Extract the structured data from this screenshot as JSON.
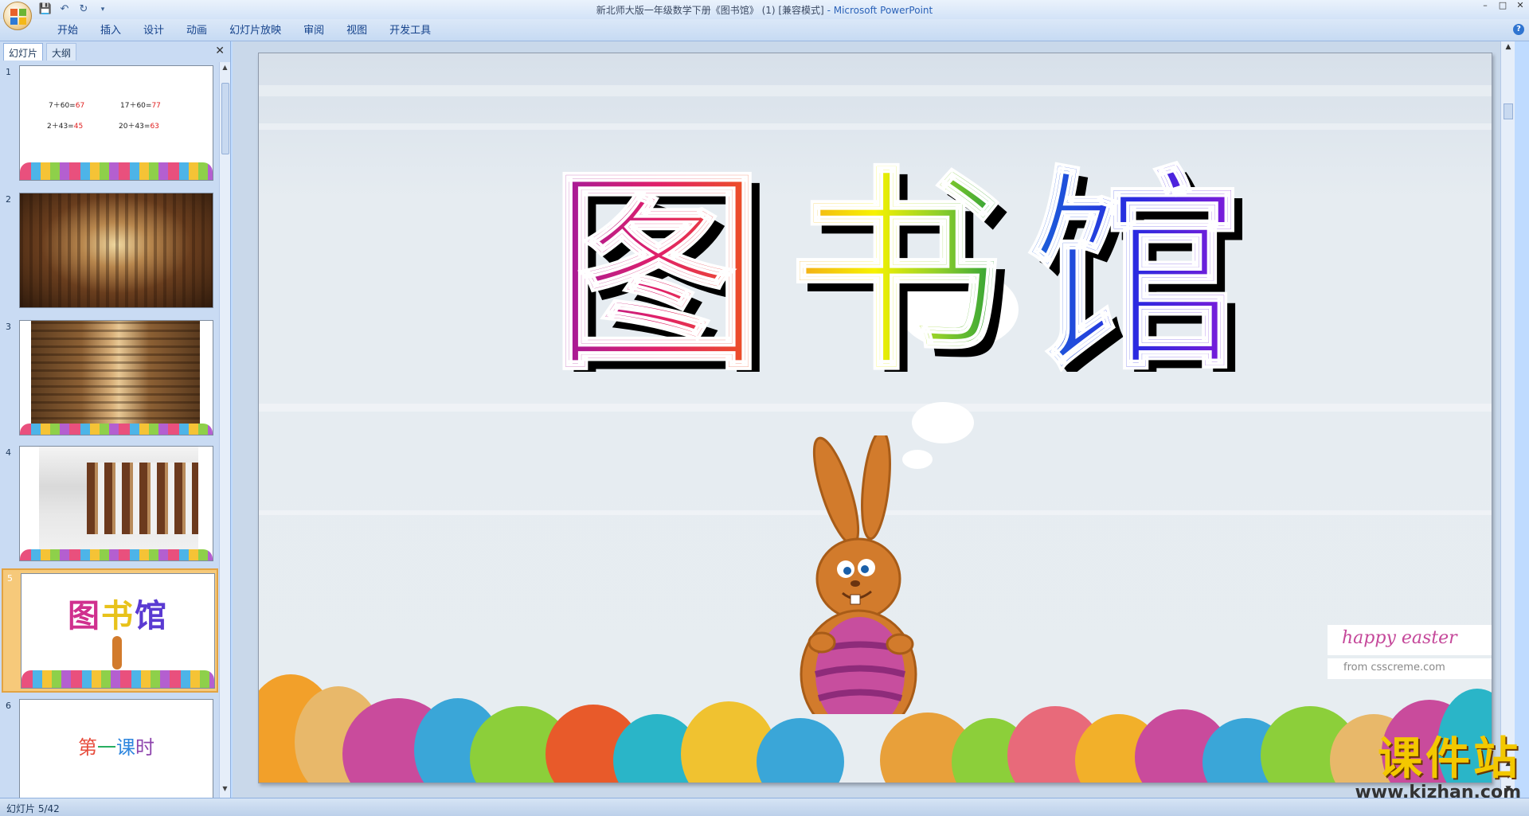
{
  "window": {
    "title": "新北师大版一年级数学下册《图书馆》 (1) [兼容模式]",
    "app_name": "- Microsoft PowerPoint"
  },
  "quick_access": {
    "save_icon": "save-icon",
    "undo_icon": "undo-icon",
    "redo_icon": "redo-icon",
    "customize_icon": "chevron-down-icon"
  },
  "ribbon_tabs": [
    "开始",
    "插入",
    "设计",
    "动画",
    "幻灯片放映",
    "审阅",
    "视图",
    "开发工具"
  ],
  "left_pane": {
    "tab_slides": "幻灯片",
    "tab_outline": "大纲",
    "close_glyph": "✕"
  },
  "thumbnails": [
    {
      "number": "1",
      "equations": [
        {
          "expr": "7＋60=",
          "answer": "67"
        },
        {
          "expr": "17＋60=",
          "answer": "77"
        },
        {
          "expr": "2＋43=",
          "answer": "45"
        },
        {
          "expr": "20＋43=",
          "answer": "63"
        }
      ]
    },
    {
      "number": "2"
    },
    {
      "number": "3"
    },
    {
      "number": "4"
    },
    {
      "number": "5",
      "title_chars": [
        "图",
        "书",
        "馆"
      ]
    },
    {
      "number": "6",
      "title_chars": [
        "第",
        "一",
        "课",
        "时"
      ]
    }
  ],
  "slide": {
    "title_chars": [
      "图",
      "书",
      "馆"
    ],
    "happy_title": "happy easter",
    "happy_sub": "from csscreme.com"
  },
  "watermark": {
    "main": "课件站",
    "url": "www.kjzhan.com"
  },
  "status": {
    "text": "幻灯片 5/42"
  },
  "colors": {
    "ribbon_text": "#15428b",
    "selected_thumb": "#f6c97a",
    "slide_bg": "#e6ecf1"
  }
}
